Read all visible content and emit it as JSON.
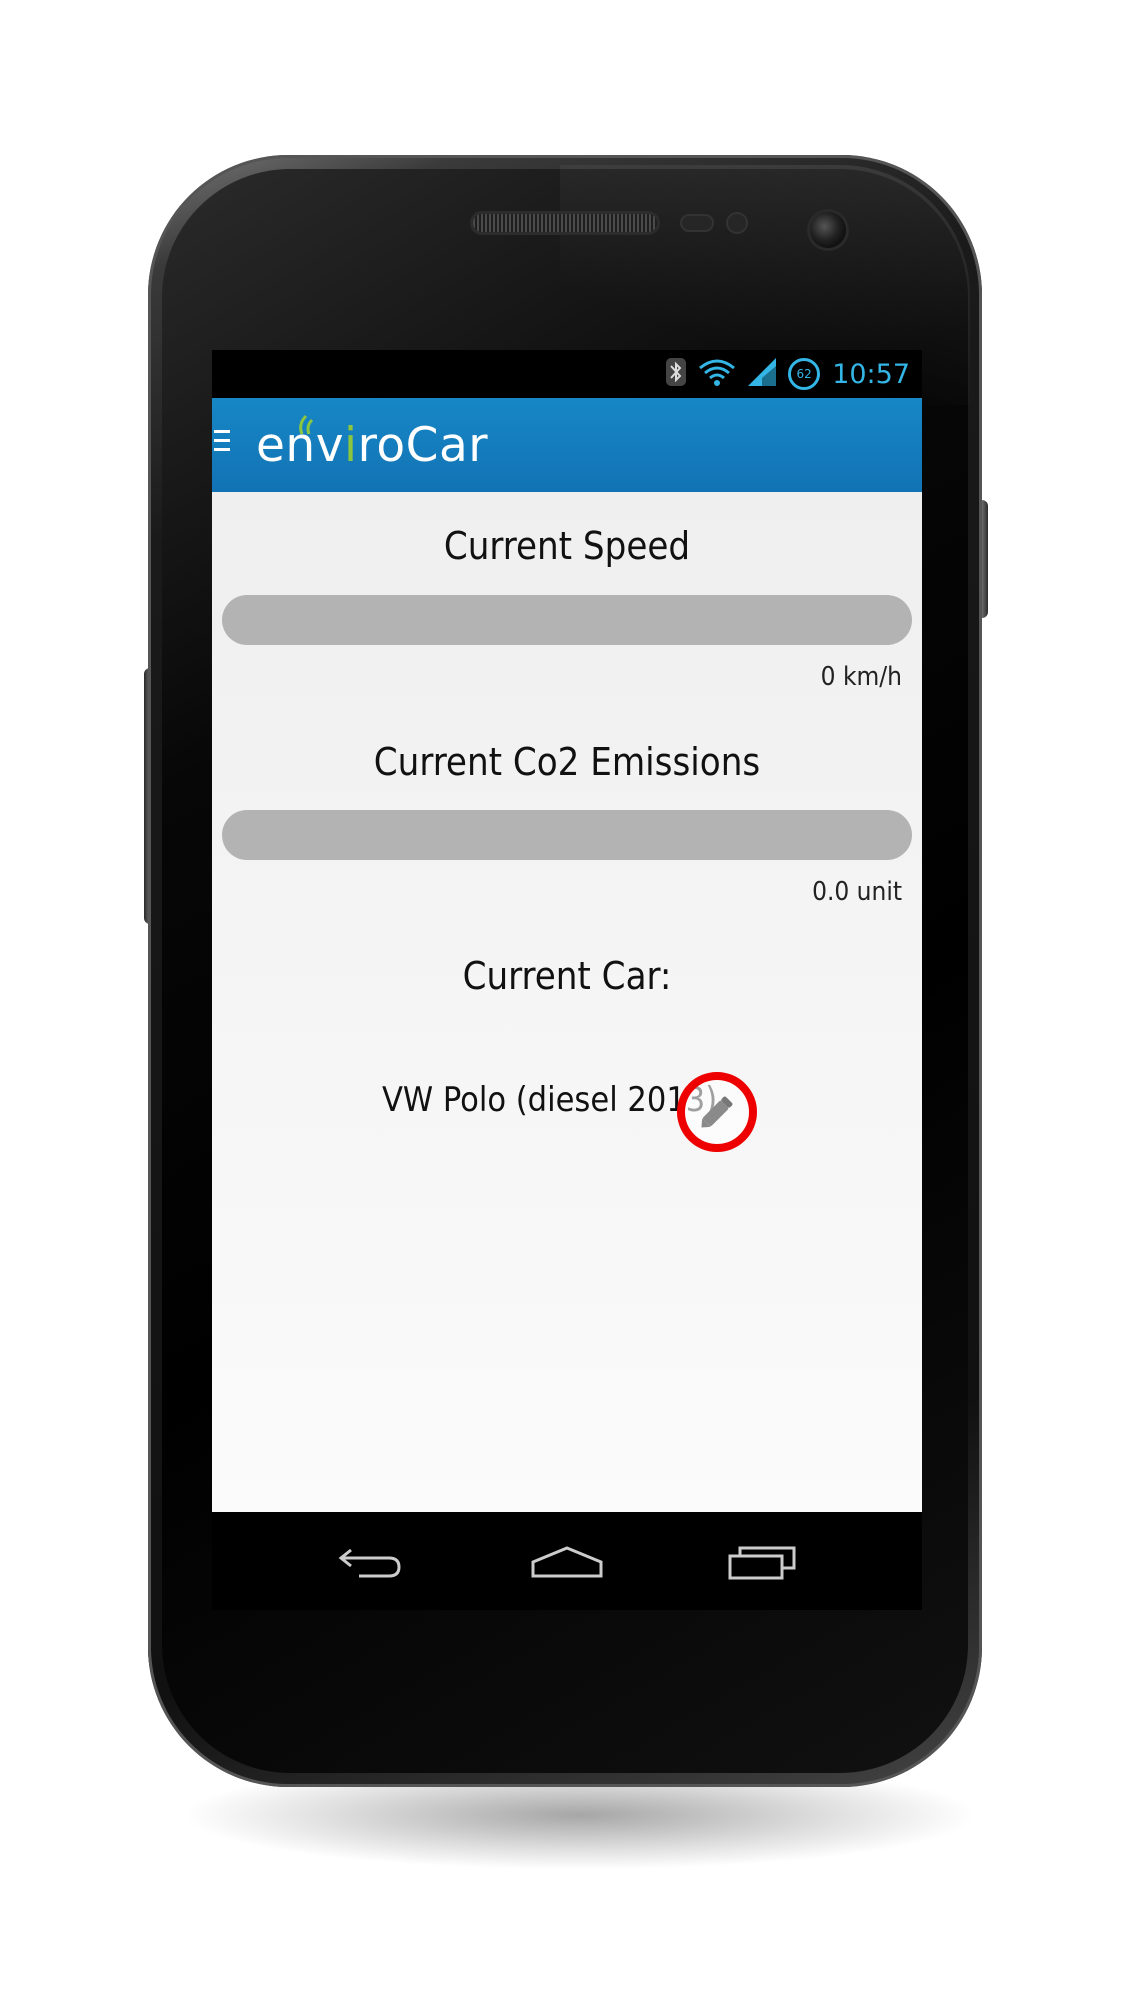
{
  "status_bar": {
    "time": "10:57",
    "battery_level": "62",
    "icons": [
      "bluetooth-icon",
      "wifi-icon",
      "signal-icon",
      "battery-icon"
    ]
  },
  "action_bar": {
    "app_name_pre": "env",
    "app_name_i": "i",
    "app_name_post": "roCar",
    "menu_icon": "hamburger-menu-icon"
  },
  "dashboard": {
    "speed": {
      "title": "Current Speed",
      "value_label": "0 km/h",
      "value": 0
    },
    "co2": {
      "title": "Current Co2 Emissions",
      "value_label": "0.0 unit",
      "value": 0.0
    },
    "car": {
      "title": "Current Car:",
      "name": "VW Polo (diesel 2013)",
      "edit_icon": "pencil-icon"
    }
  },
  "nav_bar": {
    "buttons": [
      "back-icon",
      "home-icon",
      "recent-apps-icon"
    ]
  },
  "colors": {
    "accent": "#33b5e5",
    "action_bar": "#1787c6",
    "logo_green": "#8cc63f",
    "highlight_ring": "#ee0000",
    "bar_track": "#b3b3b3"
  }
}
